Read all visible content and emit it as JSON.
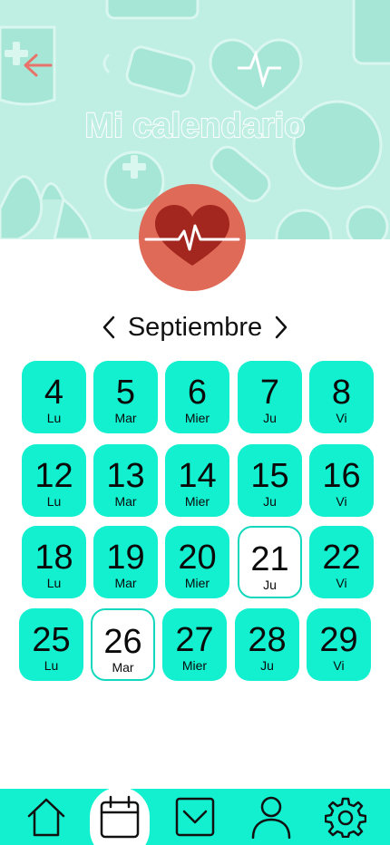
{
  "header": {
    "title": "Mi calendario",
    "back_icon": "arrow-left-icon",
    "badge_icon": "heart-pulse-icon",
    "background_color": "#bfeee3",
    "badge_color": "#e06a58"
  },
  "month_selector": {
    "prev_icon": "chevron-left-icon",
    "label": "Septiembre",
    "next_icon": "chevron-right-icon"
  },
  "calendar": {
    "day_color": "#12f0d0",
    "selected_day_color": "#ffffff",
    "weeks": [
      [
        {
          "num": "4",
          "dow": "Lu",
          "selected": false
        },
        {
          "num": "5",
          "dow": "Mar",
          "selected": false
        },
        {
          "num": "6",
          "dow": "Mier",
          "selected": false
        },
        {
          "num": "7",
          "dow": "Ju",
          "selected": false
        },
        {
          "num": "8",
          "dow": "Vi",
          "selected": false
        }
      ],
      [
        {
          "num": "12",
          "dow": "Lu",
          "selected": false
        },
        {
          "num": "13",
          "dow": "Mar",
          "selected": false
        },
        {
          "num": "14",
          "dow": "Mier",
          "selected": false
        },
        {
          "num": "15",
          "dow": "Ju",
          "selected": false
        },
        {
          "num": "16",
          "dow": "Vi",
          "selected": false
        }
      ],
      [
        {
          "num": "18",
          "dow": "Lu",
          "selected": false
        },
        {
          "num": "19",
          "dow": "Mar",
          "selected": false
        },
        {
          "num": "20",
          "dow": "Mier",
          "selected": false
        },
        {
          "num": "21",
          "dow": "Ju",
          "selected": true
        },
        {
          "num": "22",
          "dow": "Vi",
          "selected": false
        }
      ],
      [
        {
          "num": "25",
          "dow": "Lu",
          "selected": false
        },
        {
          "num": "26",
          "dow": "Mar",
          "selected": true
        },
        {
          "num": "27",
          "dow": "Mier",
          "selected": false
        },
        {
          "num": "28",
          "dow": "Ju",
          "selected": false
        },
        {
          "num": "29",
          "dow": "Vi",
          "selected": false
        }
      ]
    ]
  },
  "bottom_nav": {
    "background_color": "#12f0d0",
    "active_index": 1,
    "items": [
      {
        "icon": "home-icon"
      },
      {
        "icon": "calendar-icon"
      },
      {
        "icon": "inbox-icon"
      },
      {
        "icon": "user-icon"
      },
      {
        "icon": "gear-icon"
      }
    ]
  }
}
